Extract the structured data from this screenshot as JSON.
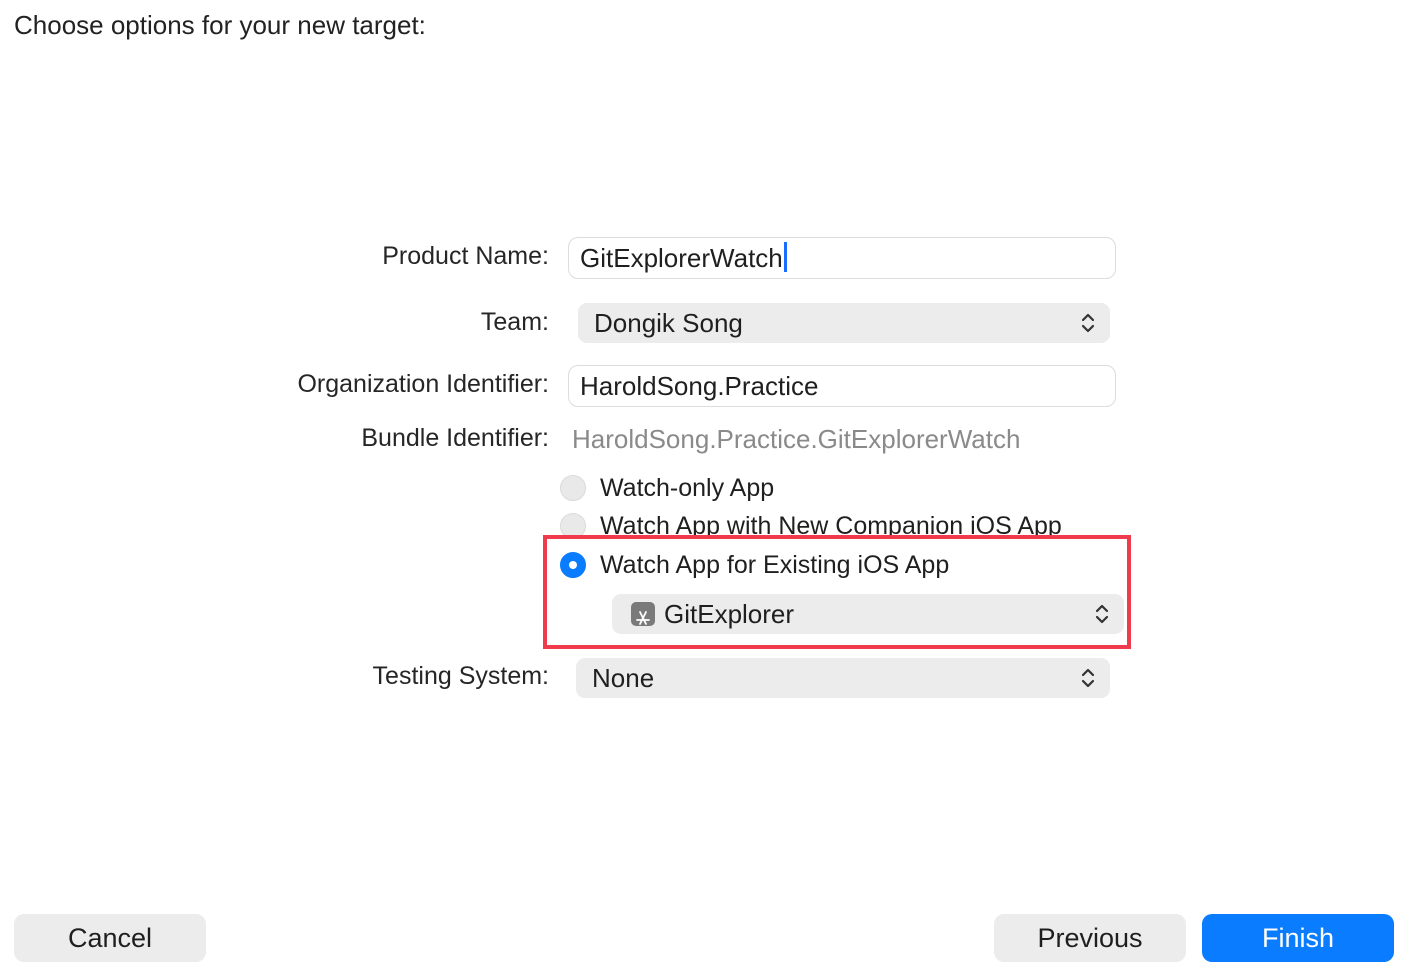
{
  "header": {
    "title": "Choose options for your new target:"
  },
  "form": {
    "product_name": {
      "label": "Product Name:",
      "value": "GitExplorerWatch"
    },
    "team": {
      "label": "Team:",
      "value": "Dongik Song"
    },
    "organization_identifier": {
      "label": "Organization Identifier:",
      "value": "HaroldSong.Practice"
    },
    "bundle_identifier": {
      "label": "Bundle Identifier:",
      "value": "HaroldSong.Practice.GitExplorerWatch"
    },
    "app_type_options": [
      {
        "label": "Watch-only App",
        "selected": false
      },
      {
        "label": "Watch App with New Companion iOS App",
        "selected": false
      },
      {
        "label": "Watch App for Existing iOS App",
        "selected": true
      }
    ],
    "existing_app": {
      "value": "GitExplorer",
      "icon": "app-store-icon"
    },
    "testing_system": {
      "label": "Testing System:",
      "value": "None"
    }
  },
  "buttons": {
    "cancel": "Cancel",
    "previous": "Previous",
    "finish": "Finish"
  },
  "colors": {
    "accent": "#0a7cff",
    "highlight": "#f03b4c"
  }
}
